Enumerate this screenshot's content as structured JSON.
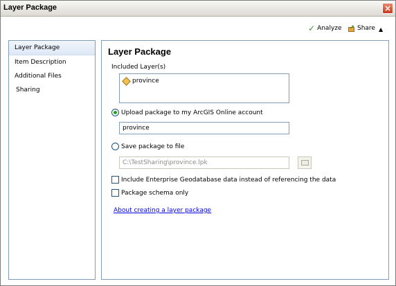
{
  "window": {
    "title": "Layer Package",
    "close_icon": "close-icon"
  },
  "toolbar": {
    "analyze_label": "Analyze",
    "share_label": "Share",
    "collapse_symbol": "▲"
  },
  "sidebar": {
    "items": [
      {
        "label": "Layer Package",
        "selected": true
      },
      {
        "label": "Item Description",
        "selected": false
      },
      {
        "label": "Additional Files",
        "selected": false
      },
      {
        "label": "Sharing",
        "selected": false
      }
    ]
  },
  "main": {
    "heading": "Layer Package",
    "included_layers_label": "Included Layer(s)",
    "layers": [
      "province"
    ],
    "upload_option_label": "Upload package to my ArcGIS Online account",
    "upload_option_selected": true,
    "upload_name_value": "province",
    "save_option_label": "Save package to file",
    "save_option_selected": false,
    "save_path_value": "C:\\TestSharing\\province.lpk",
    "enterprise_checkbox_label": "Include Enterprise Geodatabase data instead of referencing the data",
    "enterprise_checked": false,
    "schema_checkbox_label": "Package schema only",
    "schema_checked": false,
    "help_link": "About creating a layer package"
  },
  "colors": {
    "accent_green": "#3c9a1b",
    "close_red": "#c5391c",
    "border_blue": "#7f9db9",
    "link_blue": "#0000ee"
  }
}
